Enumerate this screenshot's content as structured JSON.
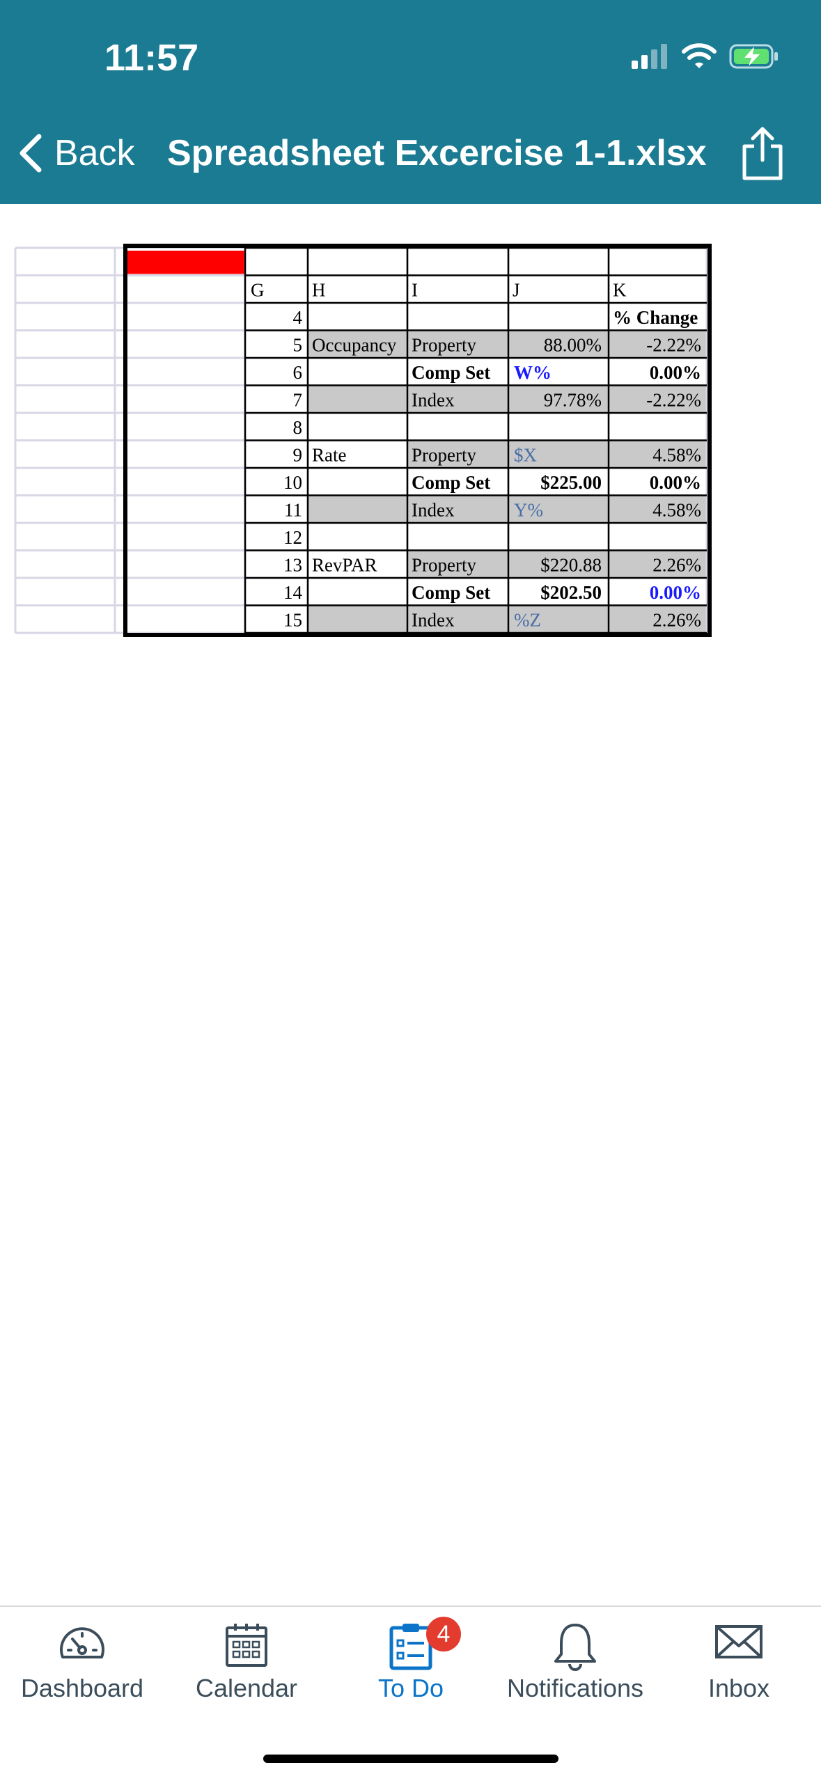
{
  "status_bar": {
    "time": "11:57"
  },
  "nav": {
    "back_label": "Back",
    "title": "Spreadsheet Excercise 1-1.xlsx"
  },
  "sheet": {
    "col_headers": [
      "G",
      "H",
      "I",
      "J",
      "K"
    ],
    "rows": [
      {
        "g": "4",
        "h": "",
        "i": "",
        "j": "",
        "k": "% Change"
      },
      {
        "g": "5",
        "h": "Occupancy",
        "i": "Property",
        "j": "88.00%",
        "k": "-2.22%"
      },
      {
        "g": "6",
        "h": "",
        "i": "Comp Set",
        "j": "W%",
        "k": "0.00%"
      },
      {
        "g": "7",
        "h": "",
        "i": "Index",
        "j": "97.78%",
        "k": "-2.22%"
      },
      {
        "g": "8",
        "h": "",
        "i": "",
        "j": "",
        "k": ""
      },
      {
        "g": "9",
        "h": "Rate",
        "i": "Property",
        "j": "$X",
        "k": "4.58%"
      },
      {
        "g": "10",
        "h": "",
        "i": "Comp Set",
        "j": "$225.00",
        "k": "0.00%"
      },
      {
        "g": "11",
        "h": "",
        "i": "Index",
        "j": "Y%",
        "k": "4.58%"
      },
      {
        "g": "12",
        "h": "",
        "i": "",
        "j": "",
        "k": ""
      },
      {
        "g": "13",
        "h": "RevPAR",
        "i": "Property",
        "j": "$220.88",
        "k": "2.26%"
      },
      {
        "g": "14",
        "h": "",
        "i": "Comp Set",
        "j": "$202.50",
        "k": "0.00%"
      },
      {
        "g": "15",
        "h": "",
        "i": "Index",
        "j": "%Z",
        "k": "2.26%"
      }
    ],
    "colors": {
      "header_red": "#ff0000",
      "grey_fill": "#c9c9c9",
      "blue_text": "#1a1aff",
      "slate_blue_text": "#4a6fa5"
    }
  },
  "tabbar": {
    "dashboard": "Dashboard",
    "calendar": "Calendar",
    "todo": "To Do",
    "todo_badge": "4",
    "notifications": "Notifications",
    "inbox": "Inbox"
  },
  "colors": {
    "nav_bg": "#1a7b92",
    "active_tab": "#0b74c8",
    "badge": "#e33b2e"
  }
}
